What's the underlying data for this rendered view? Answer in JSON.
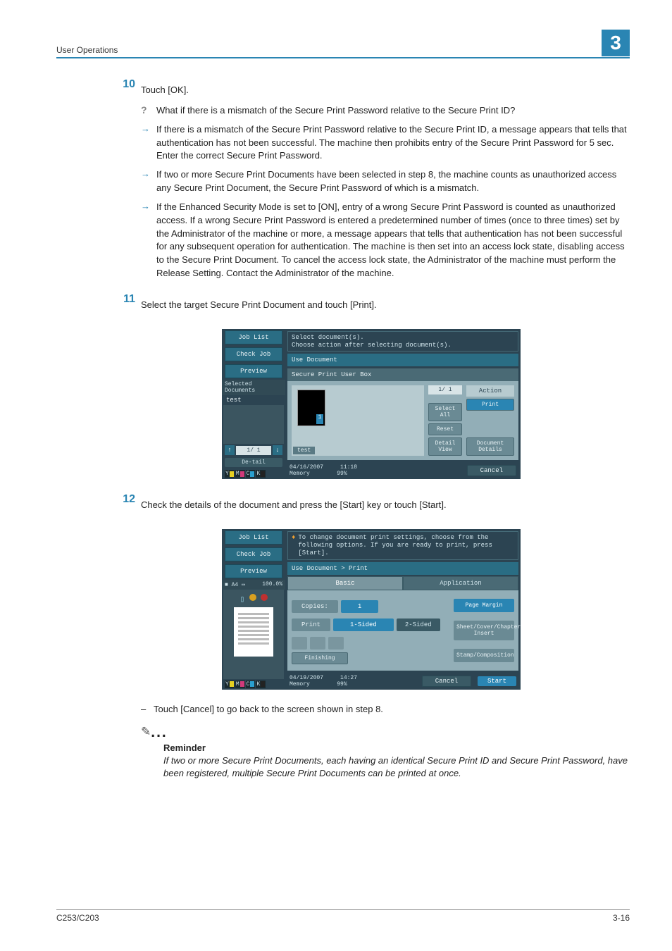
{
  "header": {
    "section": "User Operations",
    "chapter": "3"
  },
  "steps": {
    "s10": {
      "num": "10",
      "text": "Touch [OK].",
      "q": "What if there is a mismatch of the Secure Print Password relative to the Secure Print ID?",
      "a1": "If there is a mismatch of the Secure Print Password relative to the Secure Print ID, a message appears that tells that authentication has not been successful. The machine then prohibits entry of the Secure Print Password for 5 sec. Enter the correct Secure Print Password.",
      "a2": "If two or more Secure Print Documents have been selected in step 8, the machine counts as unauthorized access any Secure Print Document, the Secure Print Password of which is a mismatch.",
      "a3": "If the Enhanced Security Mode is set to [ON], entry of a wrong Secure Print Password is counted as unauthorized access. If a wrong Secure Print Password is entered a predetermined number of times (once to three times) set by the Administrator of the machine or more, a message appears that tells that authentication has not been successful for any subsequent operation for authentication. The machine is then set into an access lock state, disabling access to the Secure Print Document. To cancel the access lock state, the Administrator of the machine must perform the Release Setting. Contact the Administrator of the machine."
    },
    "s11": {
      "num": "11",
      "text": "Select the target Secure Print Document and touch [Print]."
    },
    "s12": {
      "num": "12",
      "text": "Check the details of the document and press the [Start] key or touch [Start]."
    }
  },
  "dash": "Touch [Cancel] to go back to the screen shown in step 8.",
  "reminder": {
    "title": "Reminder",
    "body": "If two or more Secure Print Documents, each having an identical Secure Print ID and Secure Print Password, have been registered, multiple Secure Print Documents can be printed at once."
  },
  "footer": {
    "left": "C253/C203",
    "right": "3-16"
  },
  "screen1": {
    "jobList": "Job List",
    "checkJob": "Check Job",
    "preview": "Preview",
    "selectedDocs": "Selected Documents",
    "docName": "test",
    "msg1": "Select document(s).",
    "msg2": "Choose action after selecting document(s).",
    "crumb": "Use Document",
    "tab": "Secure Print User Box",
    "pageInd": "1/  1",
    "thumbLabel": "test",
    "thumbPage": "1",
    "actionHdr": "Action",
    "print": "Print",
    "selectAll": "Select All",
    "reset": "Reset",
    "detailView": "Detail View",
    "docDetails": "Document Details",
    "navInd": "1/  1",
    "detailBtn": "De-tail",
    "date": "04/16/2007",
    "time": "11:18",
    "memory": "Memory",
    "memVal": "99%",
    "cancel": "Cancel"
  },
  "screen2": {
    "jobList": "Job List",
    "checkJob": "Check Job",
    "preview": "Preview",
    "paperInfo": "A4",
    "zoom": "100.0%",
    "msgIcon": "♦",
    "msg": "To change document print settings, choose from the following options. If you are ready to print, press [Start].",
    "crumb": "Use Document > Print",
    "tabBasic": "Basic",
    "tabApp": "Application",
    "copiesLbl": "Copies:",
    "copiesVal": "1",
    "printLbl": "Print",
    "oneSided": "1-Sided",
    "twoSided": "2-Sided",
    "finishing": "Finishing",
    "pageMargin": "Page Margin",
    "sheetCover": "Sheet/Cover/Chapter Insert",
    "stamp": "Stamp/Composition",
    "date": "04/19/2007",
    "time": "14:27",
    "memory": "Memory",
    "memVal": "99%",
    "cancel": "Cancel",
    "start": "Start"
  }
}
